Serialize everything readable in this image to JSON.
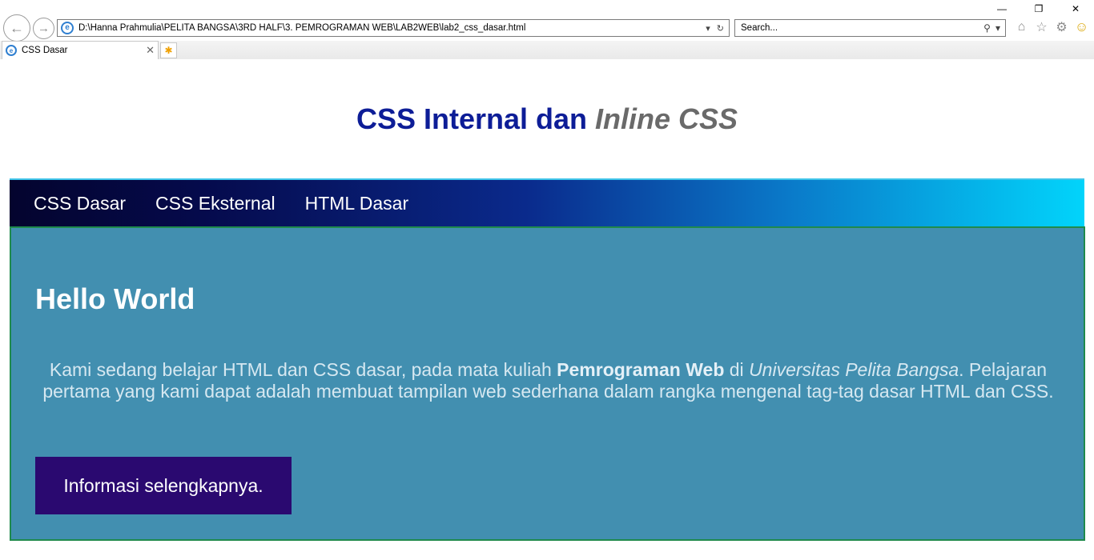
{
  "browser": {
    "address": "D:\\Hanna Prahmulia\\PELITA BANGSA\\3RD HALF\\3. PEMROGRAMAN WEB\\LAB2WEB\\lab2_css_dasar.html",
    "search_placeholder": "Search...",
    "tab_title": "CSS Dasar",
    "icons": {
      "back": "back-arrow-icon",
      "forward": "forward-arrow-icon",
      "refresh": "refresh-icon",
      "search": "search-icon",
      "home": "home-icon",
      "favorites": "star-icon",
      "settings": "gear-icon",
      "feedback": "smiley-icon"
    }
  },
  "page": {
    "title_main": "CSS Internal dan ",
    "title_italic": "Inline CSS",
    "nav": [
      {
        "label": "CSS Dasar"
      },
      {
        "label": "CSS Eksternal"
      },
      {
        "label": "HTML Dasar"
      }
    ],
    "hero": {
      "heading": "Hello World",
      "text_part1": "Kami sedang belajar HTML dan CSS dasar, pada mata kuliah ",
      "text_bold": "Pemrograman Web",
      "text_part2": " di ",
      "text_italic": "Universitas Pelita Bangsa",
      "text_part3": ". Pelajaran pertama yang kami dapat adalah membuat tampilan web sederhana dalam rangka mengenal tag-tag dasar HTML dan CSS.",
      "button_label": "Informasi selengkapnya."
    }
  },
  "colors": {
    "title_blue": "#0d1d97",
    "title_gray": "#6a6a6a",
    "hero_bg": "#428fb0",
    "hero_border": "#1f8a4c",
    "button_bg": "#2a0970",
    "nav_gradient_start": "#04042e",
    "nav_gradient_end": "#02d4fb"
  }
}
